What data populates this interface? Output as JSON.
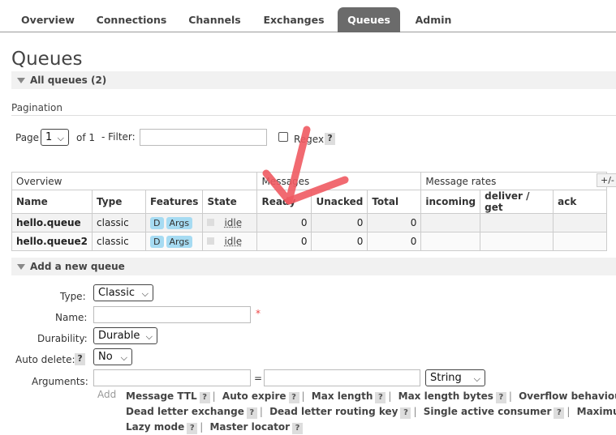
{
  "tabs": [
    {
      "label": "Overview"
    },
    {
      "label": "Connections"
    },
    {
      "label": "Channels"
    },
    {
      "label": "Exchanges"
    },
    {
      "label": "Queues"
    },
    {
      "label": "Admin"
    }
  ],
  "page_title": "Queues",
  "all_queues_header": "All queues (2)",
  "pagination": {
    "title": "Pagination",
    "page_label": "Page",
    "page_value": "1",
    "of_label": "of 1",
    "filter_label": "- Filter:",
    "filter_value": "",
    "regex_label": "Regex",
    "help": "?"
  },
  "table": {
    "groups": [
      "Overview",
      "Messages",
      "Message rates"
    ],
    "plus_minus": "+/-",
    "columns": [
      "Name",
      "Type",
      "Features",
      "State",
      "Ready",
      "Unacked",
      "Total",
      "incoming",
      "deliver / get",
      "ack"
    ],
    "rows": [
      {
        "name": "hello.queue",
        "type": "classic",
        "feature_d": "D",
        "feature_args": "Args",
        "state": "idle",
        "ready": "0",
        "unacked": "0",
        "total": "0"
      },
      {
        "name": "hello.queue2",
        "type": "classic",
        "feature_d": "D",
        "feature_args": "Args",
        "state": "idle",
        "ready": "0",
        "unacked": "0",
        "total": "0"
      }
    ]
  },
  "add_queue": {
    "header": "Add a new queue",
    "type_label": "Type:",
    "type_value": "Classic",
    "name_label": "Name:",
    "name_value": "",
    "required_mark": "*",
    "durability_label": "Durability:",
    "durability_value": "Durable",
    "auto_delete_label": "Auto delete:",
    "auto_delete_value": "No",
    "arguments_label": "Arguments:",
    "equals": "=",
    "arg_type_value": "String",
    "add_label": "Add",
    "arg_links": [
      "Message TTL",
      "Auto expire",
      "Max length",
      "Max length bytes",
      "Overflow behaviour",
      "Dead letter exchange",
      "Dead letter routing key",
      "Single active consumer",
      "Maximum",
      "Lazy mode",
      "Master locator"
    ]
  },
  "colors": {
    "active_tab": "#6b6b6b",
    "badge": "#a6dbf2",
    "annotation": "#ef5a62"
  },
  "icons": [
    "chevron-down-icon",
    "triangle-collapse-icon",
    "red-check-annotation"
  ]
}
